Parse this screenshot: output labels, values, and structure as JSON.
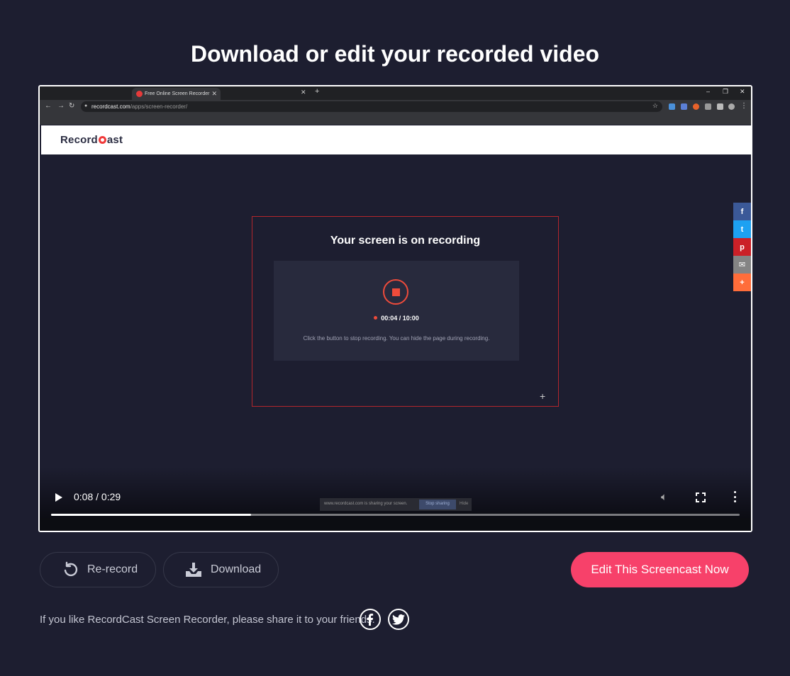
{
  "page": {
    "title": "Download or edit your recorded video"
  },
  "recording": {
    "browser": {
      "tab_title": "Free Online Screen Recorder",
      "url_host": "recordcast.com",
      "url_path": "/apps/screen-recorder/"
    },
    "site": {
      "logo_prefix": "Record",
      "logo_suffix": "ast"
    },
    "overlay": {
      "title": "Your screen is on recording",
      "timer": "00:04 / 10:00",
      "hint": "Click the button to stop recording. You can hide the page during recording."
    },
    "share_bar": {
      "facebook": "f",
      "twitter": "t",
      "pinterest": "p",
      "email": "✉",
      "more": "+"
    },
    "sharing_banner": {
      "text": "www.recordcast.com is sharing your screen.",
      "stop_label": "Stop sharing",
      "hide_label": "Hide"
    }
  },
  "player": {
    "time": "0:08 / 0:29",
    "progress": 0.29
  },
  "actions": {
    "rerecord_label": "Re-record",
    "download_label": "Download",
    "edit_label": "Edit This Screencast Now"
  },
  "share": {
    "text": "If you like RecordCast Screen Recorder, please share it to your friends."
  },
  "colors": {
    "background": "#1d1e30",
    "accent": "#f7416a",
    "record_red": "#ee4b3b"
  }
}
